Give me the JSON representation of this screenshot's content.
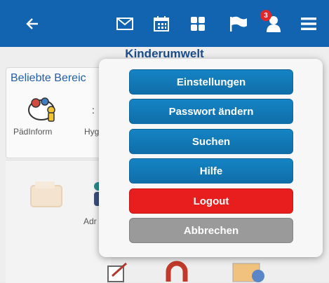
{
  "topbar": {
    "back_icon": "arrow-left-icon",
    "icons": [
      "mail-icon",
      "calendar-icon",
      "grid-icon",
      "flag-icon",
      "user-icon",
      "hamburger-menu-icon"
    ],
    "flag_badge": "3",
    "bar_color": "#1264b0",
    "badge_color": "#e3262b"
  },
  "background": {
    "section_title": "Kinderumwelt",
    "favorites_title": "Beliebte Bereic",
    "fav_items": [
      "PädInform",
      "Hyg"
    ],
    "admin_label": "Adr"
  },
  "menu": {
    "buttons": [
      {
        "label": "Einstellungen",
        "color": "#1584c4"
      },
      {
        "label": "Passwort ändern",
        "color": "#1584c4"
      },
      {
        "label": "Suchen",
        "color": "#1584c4"
      },
      {
        "label": "Hilfe",
        "color": "#1584c4"
      },
      {
        "label": "Logout",
        "color": "#e81d1d"
      },
      {
        "label": "Abbrechen",
        "color": "#9a9a9a"
      }
    ]
  }
}
